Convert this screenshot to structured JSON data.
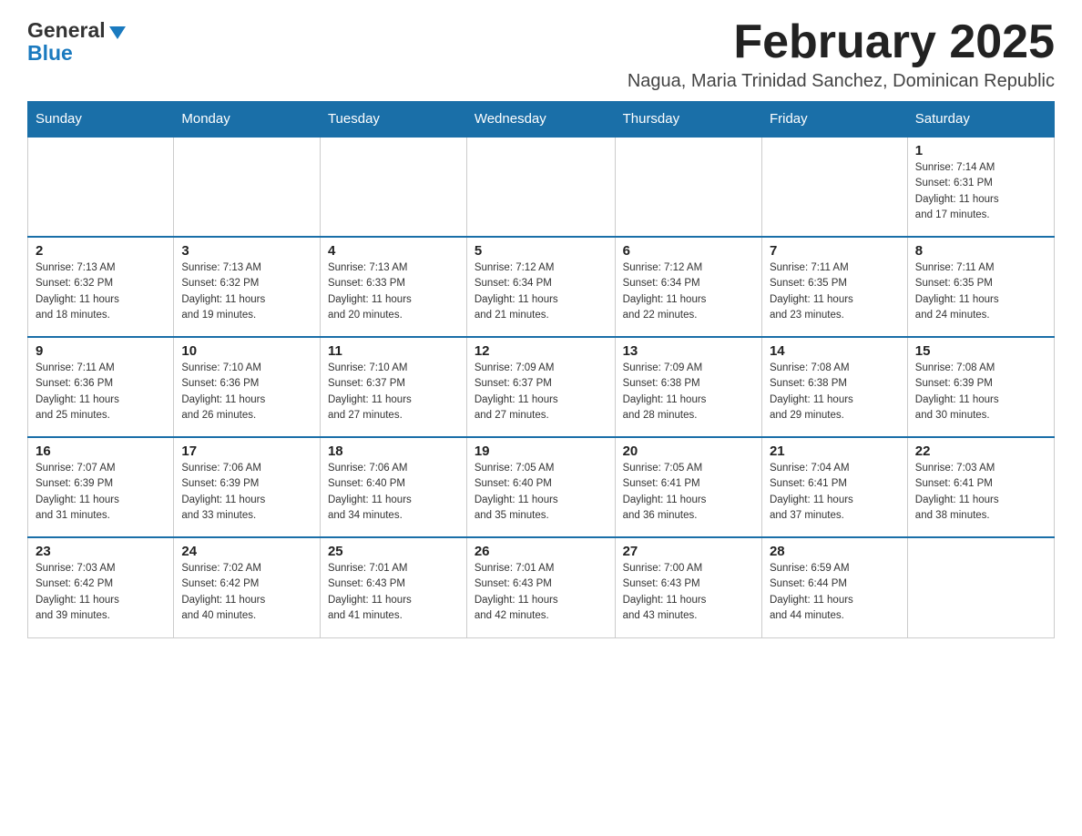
{
  "header": {
    "title": "February 2025",
    "location": "Nagua, Maria Trinidad Sanchez, Dominican Republic",
    "logo_general": "General",
    "logo_blue": "Blue"
  },
  "days_of_week": [
    "Sunday",
    "Monday",
    "Tuesday",
    "Wednesday",
    "Thursday",
    "Friday",
    "Saturday"
  ],
  "weeks": [
    [
      {
        "day": "",
        "info": ""
      },
      {
        "day": "",
        "info": ""
      },
      {
        "day": "",
        "info": ""
      },
      {
        "day": "",
        "info": ""
      },
      {
        "day": "",
        "info": ""
      },
      {
        "day": "",
        "info": ""
      },
      {
        "day": "1",
        "info": "Sunrise: 7:14 AM\nSunset: 6:31 PM\nDaylight: 11 hours\nand 17 minutes."
      }
    ],
    [
      {
        "day": "2",
        "info": "Sunrise: 7:13 AM\nSunset: 6:32 PM\nDaylight: 11 hours\nand 18 minutes."
      },
      {
        "day": "3",
        "info": "Sunrise: 7:13 AM\nSunset: 6:32 PM\nDaylight: 11 hours\nand 19 minutes."
      },
      {
        "day": "4",
        "info": "Sunrise: 7:13 AM\nSunset: 6:33 PM\nDaylight: 11 hours\nand 20 minutes."
      },
      {
        "day": "5",
        "info": "Sunrise: 7:12 AM\nSunset: 6:34 PM\nDaylight: 11 hours\nand 21 minutes."
      },
      {
        "day": "6",
        "info": "Sunrise: 7:12 AM\nSunset: 6:34 PM\nDaylight: 11 hours\nand 22 minutes."
      },
      {
        "day": "7",
        "info": "Sunrise: 7:11 AM\nSunset: 6:35 PM\nDaylight: 11 hours\nand 23 minutes."
      },
      {
        "day": "8",
        "info": "Sunrise: 7:11 AM\nSunset: 6:35 PM\nDaylight: 11 hours\nand 24 minutes."
      }
    ],
    [
      {
        "day": "9",
        "info": "Sunrise: 7:11 AM\nSunset: 6:36 PM\nDaylight: 11 hours\nand 25 minutes."
      },
      {
        "day": "10",
        "info": "Sunrise: 7:10 AM\nSunset: 6:36 PM\nDaylight: 11 hours\nand 26 minutes."
      },
      {
        "day": "11",
        "info": "Sunrise: 7:10 AM\nSunset: 6:37 PM\nDaylight: 11 hours\nand 27 minutes."
      },
      {
        "day": "12",
        "info": "Sunrise: 7:09 AM\nSunset: 6:37 PM\nDaylight: 11 hours\nand 27 minutes."
      },
      {
        "day": "13",
        "info": "Sunrise: 7:09 AM\nSunset: 6:38 PM\nDaylight: 11 hours\nand 28 minutes."
      },
      {
        "day": "14",
        "info": "Sunrise: 7:08 AM\nSunset: 6:38 PM\nDaylight: 11 hours\nand 29 minutes."
      },
      {
        "day": "15",
        "info": "Sunrise: 7:08 AM\nSunset: 6:39 PM\nDaylight: 11 hours\nand 30 minutes."
      }
    ],
    [
      {
        "day": "16",
        "info": "Sunrise: 7:07 AM\nSunset: 6:39 PM\nDaylight: 11 hours\nand 31 minutes."
      },
      {
        "day": "17",
        "info": "Sunrise: 7:06 AM\nSunset: 6:39 PM\nDaylight: 11 hours\nand 33 minutes."
      },
      {
        "day": "18",
        "info": "Sunrise: 7:06 AM\nSunset: 6:40 PM\nDaylight: 11 hours\nand 34 minutes."
      },
      {
        "day": "19",
        "info": "Sunrise: 7:05 AM\nSunset: 6:40 PM\nDaylight: 11 hours\nand 35 minutes."
      },
      {
        "day": "20",
        "info": "Sunrise: 7:05 AM\nSunset: 6:41 PM\nDaylight: 11 hours\nand 36 minutes."
      },
      {
        "day": "21",
        "info": "Sunrise: 7:04 AM\nSunset: 6:41 PM\nDaylight: 11 hours\nand 37 minutes."
      },
      {
        "day": "22",
        "info": "Sunrise: 7:03 AM\nSunset: 6:41 PM\nDaylight: 11 hours\nand 38 minutes."
      }
    ],
    [
      {
        "day": "23",
        "info": "Sunrise: 7:03 AM\nSunset: 6:42 PM\nDaylight: 11 hours\nand 39 minutes."
      },
      {
        "day": "24",
        "info": "Sunrise: 7:02 AM\nSunset: 6:42 PM\nDaylight: 11 hours\nand 40 minutes."
      },
      {
        "day": "25",
        "info": "Sunrise: 7:01 AM\nSunset: 6:43 PM\nDaylight: 11 hours\nand 41 minutes."
      },
      {
        "day": "26",
        "info": "Sunrise: 7:01 AM\nSunset: 6:43 PM\nDaylight: 11 hours\nand 42 minutes."
      },
      {
        "day": "27",
        "info": "Sunrise: 7:00 AM\nSunset: 6:43 PM\nDaylight: 11 hours\nand 43 minutes."
      },
      {
        "day": "28",
        "info": "Sunrise: 6:59 AM\nSunset: 6:44 PM\nDaylight: 11 hours\nand 44 minutes."
      },
      {
        "day": "",
        "info": ""
      }
    ]
  ]
}
